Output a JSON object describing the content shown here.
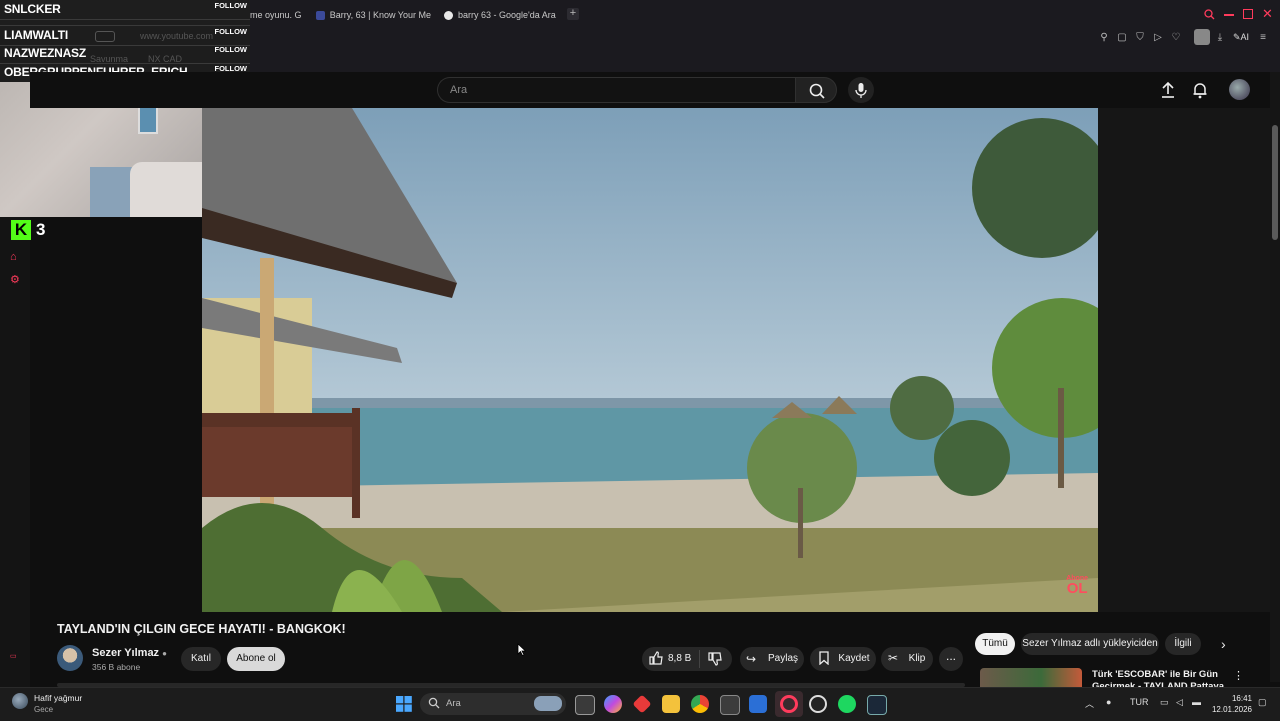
{
  "chat_overlay": {
    "rows": [
      {
        "name": "SNLCKER",
        "follow": "FOLLOW"
      },
      {
        "name": "LIAMWALTI",
        "follow": "FOLLOW"
      },
      {
        "name": "NAZWEZNASZ",
        "follow": "FOLLOW"
      },
      {
        "name": "OBERGRUPPENFUHRER_ERICH",
        "follow": "FOLLOW"
      }
    ],
    "ghost_url": "www.youtube.com",
    "ghost_bookmarks": [
      "Savunma",
      "NX CAD"
    ],
    "kick_count": "3"
  },
  "browser": {
    "tabs": [
      {
        "label": "me oyunu. Gi",
        "color": "#3a3a3a"
      },
      {
        "label": "Barry, 63 | Know Your Me",
        "color": "#3b4a9a"
      },
      {
        "label": "barry 63 - Google'da Ara",
        "color": "#e8e8e8"
      }
    ],
    "new_tab": "+",
    "ai_label": "AI"
  },
  "youtube": {
    "search_placeholder": "Ara",
    "video_title": "TAYLAND'IN ÇILGIN GECE HAYATI! - BANGKOK!",
    "channel_name": "Sezer Yılmaz",
    "subscribers": "356 B abone",
    "join_label": "Katıl",
    "subscribe_label": "Abone ol",
    "likes": "8,8 B",
    "share_label": "Paylaş",
    "save_label": "Kaydet",
    "clip_label": "Klip",
    "more_label": "...",
    "watermark_top": "Abone",
    "watermark_bottom": "OL",
    "chips": [
      "Tümü",
      "Sezer Yılmaz adlı yükleyiciden",
      "İlgili"
    ],
    "related_title_1": "Türk 'ESCOBAR' ile Bir Gün",
    "related_title_2": "Geçirmek - TAYLAND Pattaya"
  },
  "taskbar": {
    "weather_line1": "Hafif yağmur",
    "weather_line2": "Gece",
    "search_placeholder": "Ara",
    "lang": "TUR",
    "time": "16:41",
    "date": "12.01.2026"
  },
  "colors": {
    "accent_red": "#ff3b5c",
    "kick_green": "#53fc18",
    "yt_bg": "#0f0f0f"
  }
}
